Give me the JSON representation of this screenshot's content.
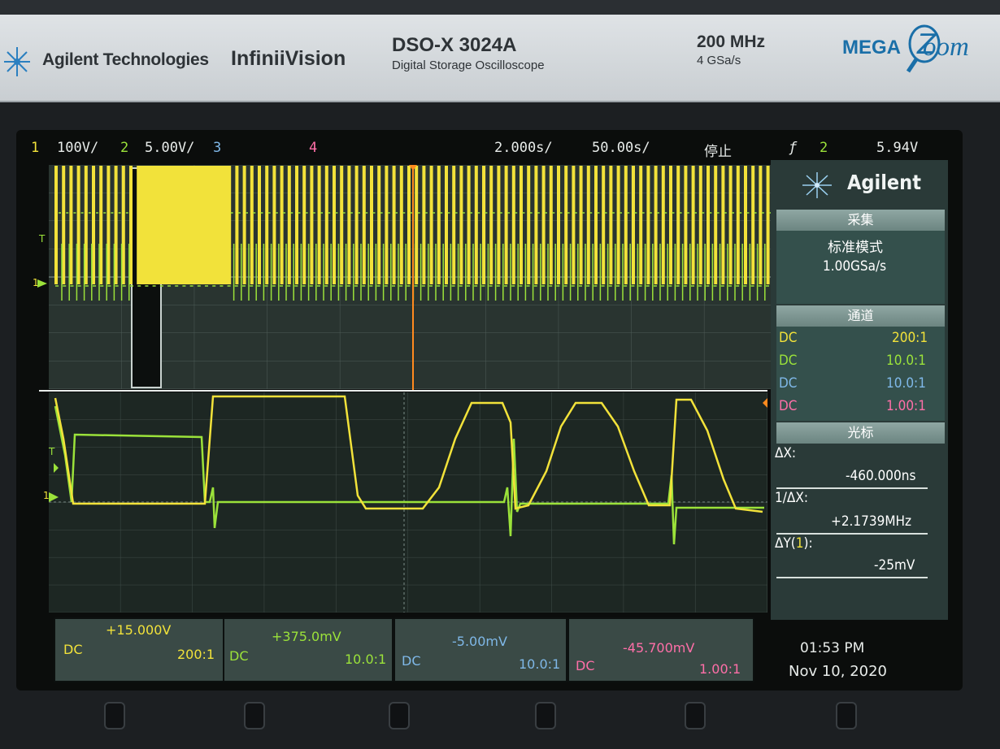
{
  "brand": {
    "company": "Agilent Technologies",
    "series": "InfiniiVision",
    "model": "DSO-X 3024A",
    "model_desc": "Digital Storage Oscilloscope",
    "bandwidth": "200 MHz",
    "sample_rate": "4 GSa/s",
    "mega": "MEGA",
    "zoom": "oom"
  },
  "status": {
    "ch1_num": "1",
    "ch1_scale": "100V/",
    "ch2_num": "2",
    "ch2_scale": "5.00V/",
    "ch3_num": "3",
    "ch4_num": "4",
    "time_scale": "2.000s/",
    "delay": "50.00s/",
    "run_state": "停止",
    "trigger_icon": "ƒ",
    "trigger_channel": "2",
    "trigger_level": "5.94V"
  },
  "panel": {
    "logo_text": "Agilent",
    "acquire_title": "采集",
    "acquire_mode": "标准模式",
    "acquire_rate": "1.00GSa/s",
    "channels_title": "通道",
    "channels": [
      {
        "coupling": "DC",
        "probe": "200:1",
        "color": "#f2e23a"
      },
      {
        "coupling": "DC",
        "probe": "10.0:1",
        "color": "#9be23a"
      },
      {
        "coupling": "DC",
        "probe": "10.0:1",
        "color": "#7fb8e8"
      },
      {
        "coupling": "DC",
        "probe": "1.00:1",
        "color": "#ff6fa8"
      }
    ],
    "cursors_title": "光标",
    "dx_label": "ΔX:",
    "dx_value": "-460.000ns",
    "inv_dx_label": "1/ΔX:",
    "inv_dx_value": "+2.1739MHz",
    "dy_label_a": "ΔY(",
    "dy_label_ch": "1",
    "dy_label_b": "):",
    "dy_value": "-25mV"
  },
  "channel_bar": [
    {
      "offset": "+15.000V",
      "coupling": "DC",
      "probe": "200:1",
      "color": "#f2e23a"
    },
    {
      "offset": "+375.0mV",
      "coupling": "DC",
      "probe": "10.0:1",
      "color": "#9be23a"
    },
    {
      "offset": "-5.00mV",
      "coupling": "DC",
      "probe": "10.0:1",
      "color": "#7fb8e8"
    },
    {
      "offset": "-45.700mV",
      "coupling": "DC",
      "probe": "1.00:1",
      "color": "#ff6fa8"
    }
  ],
  "clock": {
    "time": "01:53 PM",
    "date": "Nov 10, 2020"
  },
  "markers": {
    "trigger_marker": "T",
    "ground_marker": "1"
  },
  "colors": {
    "ch1": "#f2e23a",
    "ch2": "#9be23a",
    "ch3": "#7fb8e8",
    "ch4": "#ff6fa8",
    "cursor": "#ff8a1e",
    "brand_blue": "#1a6fa8"
  }
}
